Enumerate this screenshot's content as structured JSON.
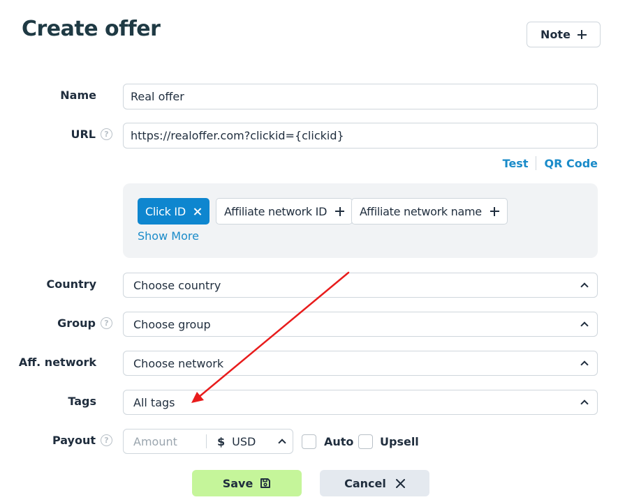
{
  "header": {
    "title": "Create offer",
    "note_label": "Note"
  },
  "fields": {
    "name": {
      "label": "Name",
      "value": "Real offer"
    },
    "url": {
      "label": "URL",
      "value": "https://realoffer.com?clickid={clickid}"
    },
    "url_actions": {
      "test": "Test",
      "qr": "QR Code"
    },
    "tokens": {
      "items": [
        "Click ID",
        "Affiliate network ID",
        "Affiliate network name"
      ],
      "show_more": "Show More"
    },
    "country": {
      "label": "Country",
      "placeholder": "Choose country"
    },
    "group": {
      "label": "Group",
      "placeholder": "Choose group"
    },
    "network": {
      "label": "Aff. network",
      "placeholder": "Choose network"
    },
    "tags": {
      "label": "Tags",
      "placeholder": "All tags"
    },
    "payout": {
      "label": "Payout",
      "amount_placeholder": "Amount",
      "currency_symbol": "$",
      "currency": "USD",
      "auto": "Auto",
      "upsell": "Upsell"
    }
  },
  "footer": {
    "save": "Save",
    "cancel": "Cancel"
  },
  "colors": {
    "accent": "#0e86cf",
    "link": "#1a8bc9",
    "save_bg": "#c5f59a",
    "cancel_bg": "#e4e9ef",
    "annotation_arrow": "#e81c1c"
  }
}
